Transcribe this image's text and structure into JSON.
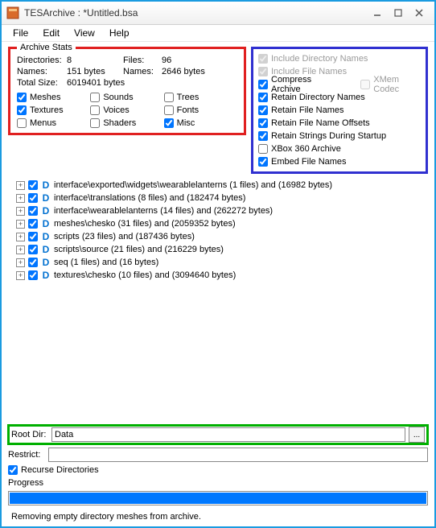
{
  "titlebar": {
    "title": "TESArchive : *Untitled.bsa"
  },
  "menu": {
    "file": "File",
    "edit": "Edit",
    "view": "View",
    "help": "Help"
  },
  "stats": {
    "legend": "Archive Stats",
    "dir_label": "Directories:",
    "dir_value": "8",
    "files_label": "Files:",
    "files_value": "96",
    "names_label": "Names:",
    "names_value": "151 bytes",
    "names2_label": "Names:",
    "names2_value": "2646 bytes",
    "total_label": "Total Size:",
    "total_value": "6019401 bytes",
    "checks": {
      "meshes": "Meshes",
      "textures": "Textures",
      "menus": "Menus",
      "sounds": "Sounds",
      "voices": "Voices",
      "shaders": "Shaders",
      "trees": "Trees",
      "fonts": "Fonts",
      "misc": "Misc"
    },
    "checked": {
      "meshes": true,
      "textures": true,
      "menus": false,
      "sounds": false,
      "voices": false,
      "shaders": false,
      "trees": false,
      "fonts": false,
      "misc": true
    }
  },
  "flags": {
    "include_dir_names": "Include Directory Names",
    "include_file_names": "Include File Names",
    "compress_archive": "Compress Archive",
    "xmem_codec": "XMem Codec",
    "retain_dir_names": "Retain Directory Names",
    "retain_file_names": "Retain File Names",
    "retain_fn_offsets": "Retain File Name Offsets",
    "retain_strings": "Retain Strings During Startup",
    "xbox_archive": "XBox 360 Archive",
    "embed_file_names": "Embed File Names"
  },
  "tree": [
    "interface\\exported\\widgets\\wearablelanterns (1 files) and (16982 bytes)",
    "interface\\translations (8 files) and (182474 bytes)",
    "interface\\wearablelanterns (14 files) and (262272 bytes)",
    "meshes\\chesko (31 files) and (2059352 bytes)",
    "scripts (23 files) and (187436 bytes)",
    "scripts\\source (21 files) and (216229 bytes)",
    "seq (1 files) and (16 bytes)",
    "textures\\chesko (10 files) and (3094640 bytes)"
  ],
  "bottom": {
    "root_dir_label": "Root Dir:",
    "root_dir_value": "Data",
    "restrict_label": "Restrict:",
    "restrict_value": "",
    "recurse_label": "Recurse Directories",
    "progress_label": "Progress",
    "status_text": "Removing empty directory meshes from archive."
  },
  "colors": {
    "red_outline": "#e02020",
    "blue_outline": "#3030d0",
    "green_outline": "#00b000",
    "progress_fill": "#0078ff"
  }
}
